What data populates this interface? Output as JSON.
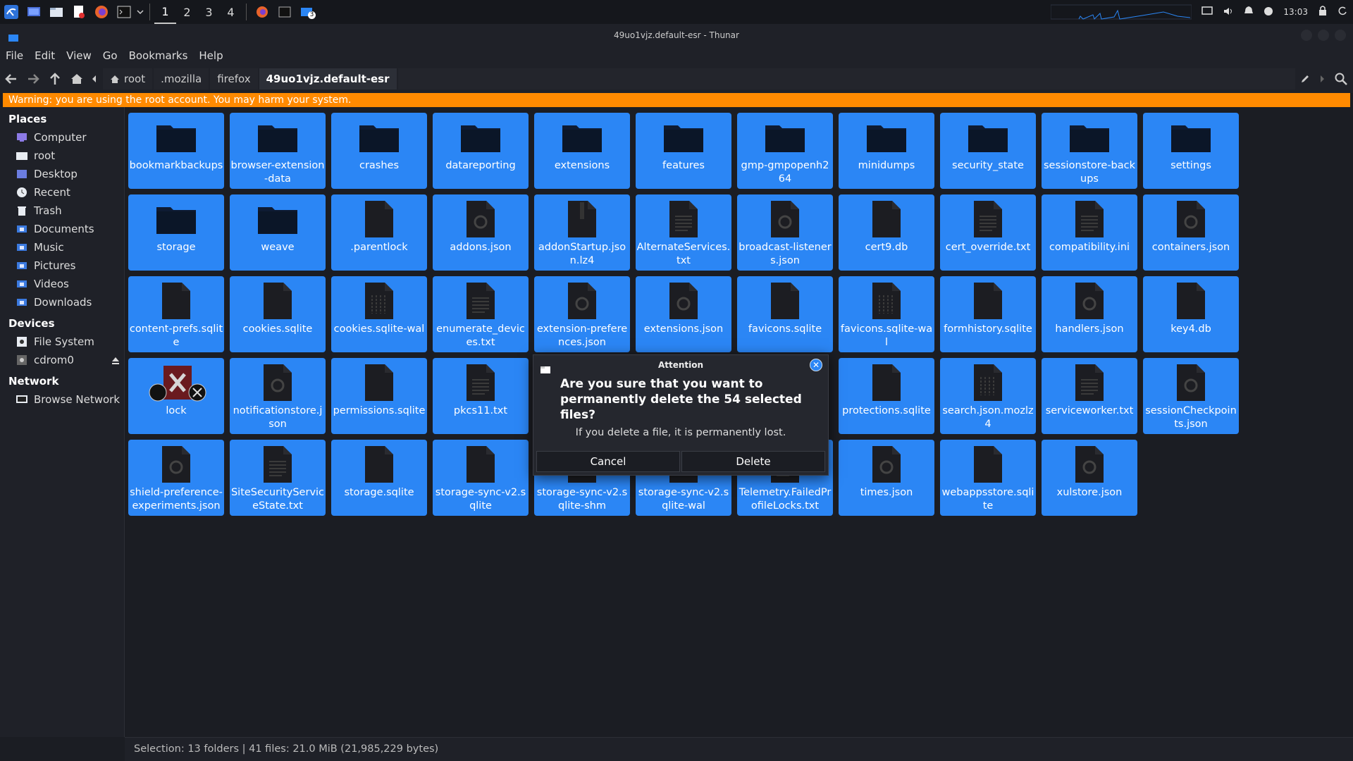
{
  "window": {
    "title": "49uo1vjz.default-esr - Thunar"
  },
  "taskbar": {
    "workspaces": [
      "1",
      "2",
      "3",
      "4"
    ],
    "active_workspace": "1",
    "badge": "3",
    "clock": "13:03"
  },
  "menu": [
    "File",
    "Edit",
    "View",
    "Go",
    "Bookmarks",
    "Help"
  ],
  "breadcrumb": [
    "root",
    ".mozilla",
    "firefox",
    "49uo1vjz.default-esr"
  ],
  "warning": "Warning: you are using the root account. You may harm your system.",
  "sidebar": {
    "places_title": "Places",
    "places": [
      {
        "label": "Computer",
        "icon": "computer-icon"
      },
      {
        "label": "root",
        "icon": "home-folder-icon"
      },
      {
        "label": "Desktop",
        "icon": "desktop-icon"
      },
      {
        "label": "Recent",
        "icon": "recent-icon"
      },
      {
        "label": "Trash",
        "icon": "trash-icon"
      },
      {
        "label": "Documents",
        "icon": "documents-folder-icon"
      },
      {
        "label": "Music",
        "icon": "music-folder-icon"
      },
      {
        "label": "Pictures",
        "icon": "pictures-folder-icon"
      },
      {
        "label": "Videos",
        "icon": "videos-folder-icon"
      },
      {
        "label": "Downloads",
        "icon": "downloads-folder-icon"
      }
    ],
    "devices_title": "Devices",
    "devices": [
      {
        "label": "File System",
        "icon": "drive-icon"
      },
      {
        "label": "cdrom0",
        "icon": "optical-drive-icon"
      }
    ],
    "network_title": "Network",
    "network": [
      {
        "label": "Browse Network",
        "icon": "network-icon"
      }
    ]
  },
  "files": [
    {
      "name": "bookmarkbackups",
      "type": "folder"
    },
    {
      "name": "browser-extension-data",
      "type": "folder"
    },
    {
      "name": "crashes",
      "type": "folder"
    },
    {
      "name": "datareporting",
      "type": "folder"
    },
    {
      "name": "extensions",
      "type": "folder"
    },
    {
      "name": "features",
      "type": "folder"
    },
    {
      "name": "gmp-gmpopenh264",
      "type": "folder"
    },
    {
      "name": "minidumps",
      "type": "folder"
    },
    {
      "name": "security_state",
      "type": "folder"
    },
    {
      "name": "sessionstore-backups",
      "type": "folder"
    },
    {
      "name": "settings",
      "type": "folder"
    },
    {
      "name": "storage",
      "type": "folder"
    },
    {
      "name": "weave",
      "type": "folder"
    },
    {
      "name": ".parentlock",
      "type": "file"
    },
    {
      "name": "addons.json",
      "type": "json"
    },
    {
      "name": "addonStartup.json.lz4",
      "type": "archive"
    },
    {
      "name": "AlternateServices.txt",
      "type": "text"
    },
    {
      "name": "broadcast-listeners.json",
      "type": "json"
    },
    {
      "name": "cert9.db",
      "type": "file"
    },
    {
      "name": "cert_override.txt",
      "type": "text"
    },
    {
      "name": "compatibility.ini",
      "type": "text"
    },
    {
      "name": "containers.json",
      "type": "json"
    },
    {
      "name": "content-prefs.sqlite",
      "type": "file"
    },
    {
      "name": "cookies.sqlite",
      "type": "file"
    },
    {
      "name": "cookies.sqlite-wal",
      "type": "binary"
    },
    {
      "name": "enumerate_devices.txt",
      "type": "text"
    },
    {
      "name": "extension-preferences.json",
      "type": "json"
    },
    {
      "name": "extensions.json",
      "type": "json"
    },
    {
      "name": "favicons.sqlite",
      "type": "file"
    },
    {
      "name": "favicons.sqlite-wal",
      "type": "binary"
    },
    {
      "name": "formhistory.sqlite",
      "type": "file"
    },
    {
      "name": "handlers.json",
      "type": "json"
    },
    {
      "name": "key4.db",
      "type": "file"
    },
    {
      "name": "lock",
      "type": "broken-link"
    },
    {
      "name": "notificationstore.json",
      "type": "json"
    },
    {
      "name": "permissions.sqlite",
      "type": "file"
    },
    {
      "name": "pkcs11.txt",
      "type": "text"
    },
    {
      "name": "",
      "type": "hidden"
    },
    {
      "name": "",
      "type": "hidden"
    },
    {
      "name": "",
      "type": "hidden"
    },
    {
      "name": "protections.sqlite",
      "type": "file"
    },
    {
      "name": "search.json.mozlz4",
      "type": "binary"
    },
    {
      "name": "serviceworker.txt",
      "type": "text"
    },
    {
      "name": "sessionCheckpoints.json",
      "type": "json"
    },
    {
      "name": "shield-preference-experiments.json",
      "type": "json"
    },
    {
      "name": "SiteSecurityServiceState.txt",
      "type": "text"
    },
    {
      "name": "storage.sqlite",
      "type": "file"
    },
    {
      "name": "storage-sync-v2.sqlite",
      "type": "file"
    },
    {
      "name": "storage-sync-v2.sqlite-shm",
      "type": "file"
    },
    {
      "name": "storage-sync-v2.sqlite-wal",
      "type": "file"
    },
    {
      "name": "Telemetry.FailedProfileLocks.txt",
      "type": "text"
    },
    {
      "name": "times.json",
      "type": "json"
    },
    {
      "name": "webappsstore.sqlite",
      "type": "file"
    },
    {
      "name": "xulstore.json",
      "type": "json"
    }
  ],
  "status": "Selection: 13 folders | 41 files: 21.0 MiB (21,985,229 bytes)",
  "dialog": {
    "title": "Attention",
    "heading": "Are you sure that you want to permanently delete the 54 selected files?",
    "body": "If you delete a file, it is permanently lost.",
    "cancel": "Cancel",
    "delete": "Delete"
  },
  "colors": {
    "selection": "#2b86f5",
    "warning": "#ff8a00",
    "background": "#1b1d23"
  }
}
